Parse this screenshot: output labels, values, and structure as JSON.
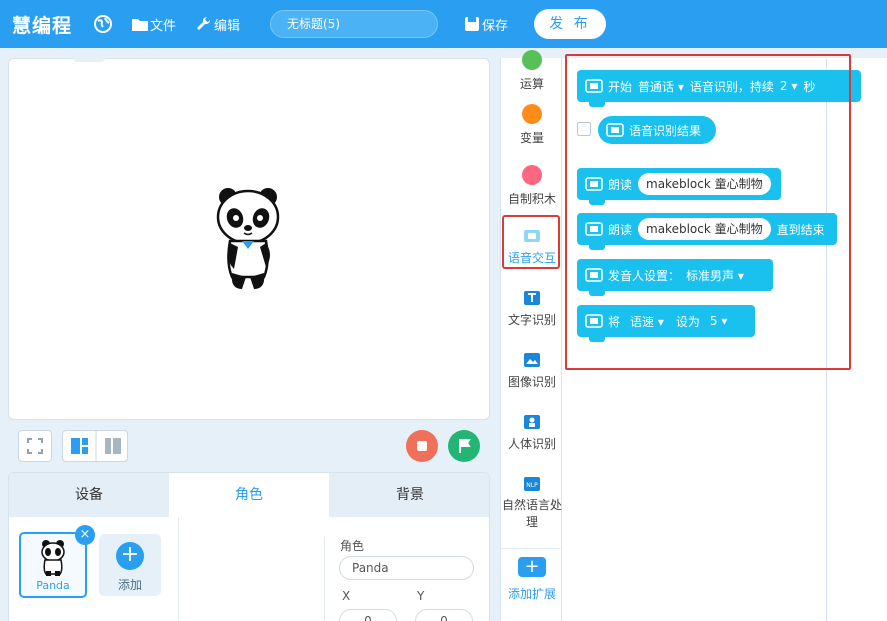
{
  "topbar": {
    "logo": "慧编程",
    "file_label": "文件",
    "edit_label": "编辑",
    "project_title": "无标题(5)",
    "save_label": "保存",
    "publish_label": "发 布"
  },
  "stage": {
    "sprite_alt": "Panda"
  },
  "bottom_panel": {
    "tabs": [
      {
        "label": "设备"
      },
      {
        "label": "角色"
      },
      {
        "label": "背景"
      }
    ],
    "sprite_name": "Panda",
    "add_label": "添加",
    "prop_sprite_label": "角色",
    "prop_sprite_value": "Panda",
    "prop_x_label": "X",
    "prop_y_label": "Y",
    "prop_x_value": "0",
    "prop_y_value": "0"
  },
  "categories": [
    {
      "label": "运算",
      "color": "#59c059"
    },
    {
      "label": "变量",
      "color": "#ff8c1a"
    },
    {
      "label": "自制积木",
      "color": "#ff6680"
    },
    {
      "label": "语音交互"
    },
    {
      "label": "文字识别"
    },
    {
      "label": "图像识别"
    },
    {
      "label": "人体识别"
    },
    {
      "label": "自然语言处理"
    }
  ],
  "add_extension_label": "添加扩展",
  "blocks": {
    "start_recognize": {
      "t1": "开始",
      "lang": "普通话",
      "t2": "语音识别，持续",
      "secs": "2",
      "t3": "秒"
    },
    "result_reporter": "语音识别结果",
    "speak1": {
      "t1": "朗读",
      "text": "makeblock",
      "text2": "童心制物"
    },
    "speak2": {
      "t1": "朗读",
      "text": "makeblock",
      "text2": "童心制物",
      "t2": "直到结束"
    },
    "voice_setting": {
      "t1": "发音人设置：",
      "value": "标准男声"
    },
    "set_param": {
      "t1": "将",
      "param": "语速",
      "t2": "设为",
      "value": "5"
    }
  },
  "colors": {
    "accent": "#2a9ff1",
    "block": "#1ac1ef",
    "highlight_box": "#d93a3a",
    "stop": "#f0705b",
    "go": "#22b573"
  }
}
